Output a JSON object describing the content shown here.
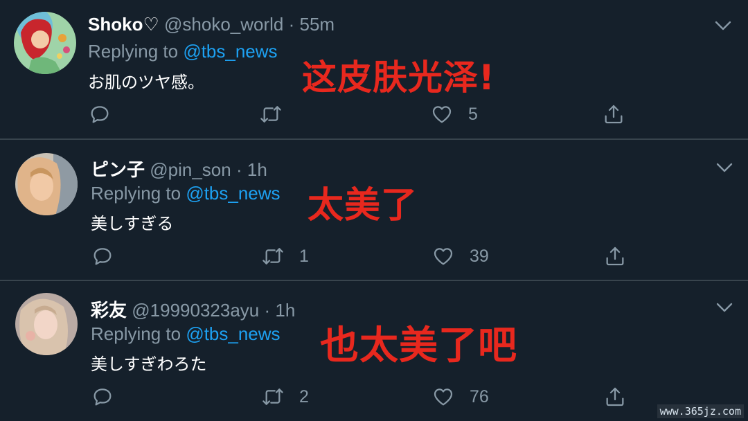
{
  "tweets": [
    {
      "name": "Shoko♡",
      "handle": "@shoko_world",
      "time": "55m",
      "replying_prefix": "Replying to",
      "replying_to": "@tbs_news",
      "text": "お肌のツヤ感。",
      "retweets": "",
      "likes": "5",
      "overlay": "这皮肤光泽!"
    },
    {
      "name": "ピン子",
      "handle": "@pin_son",
      "time": "1h",
      "replying_prefix": "Replying to",
      "replying_to": "@tbs_news",
      "text": "美しすぎる",
      "retweets": "1",
      "likes": "39",
      "overlay": "太美了"
    },
    {
      "name": "彩友",
      "handle": "@19990323ayu",
      "time": "1h",
      "replying_prefix": "Replying to",
      "replying_to": "@tbs_news",
      "text": "美しすぎわろた",
      "retweets": "2",
      "likes": "76",
      "overlay": "也太美了吧"
    }
  ],
  "separator": "·",
  "watermark": "www.365jz.com",
  "icons": {
    "reply": "reply-icon",
    "retweet": "retweet-icon",
    "like": "heart-icon",
    "share": "share-icon",
    "menu": "chevron-down-icon"
  },
  "colors": {
    "background": "#15202b",
    "divider": "#38444d",
    "secondary_text": "#8899a6",
    "mention": "#1da1f2",
    "overlay_red": "#e8281e"
  }
}
